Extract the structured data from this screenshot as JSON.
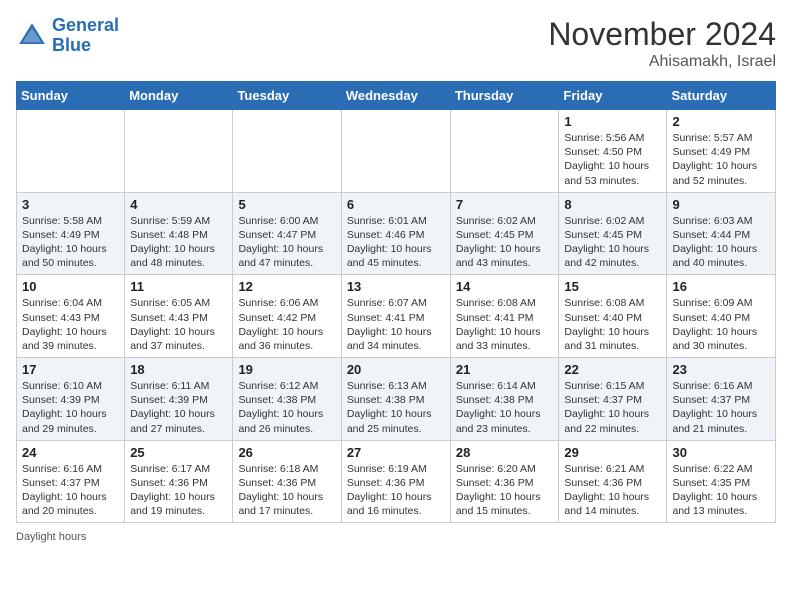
{
  "header": {
    "logo_line1": "General",
    "logo_line2": "Blue",
    "month": "November 2024",
    "location": "Ahisamakh, Israel"
  },
  "footer": {
    "daylight_label": "Daylight hours"
  },
  "weekdays": [
    "Sunday",
    "Monday",
    "Tuesday",
    "Wednesday",
    "Thursday",
    "Friday",
    "Saturday"
  ],
  "weeks": [
    [
      {
        "day": "",
        "info": ""
      },
      {
        "day": "",
        "info": ""
      },
      {
        "day": "",
        "info": ""
      },
      {
        "day": "",
        "info": ""
      },
      {
        "day": "",
        "info": ""
      },
      {
        "day": "1",
        "info": "Sunrise: 5:56 AM\nSunset: 4:50 PM\nDaylight: 10 hours and 53 minutes."
      },
      {
        "day": "2",
        "info": "Sunrise: 5:57 AM\nSunset: 4:49 PM\nDaylight: 10 hours and 52 minutes."
      }
    ],
    [
      {
        "day": "3",
        "info": "Sunrise: 5:58 AM\nSunset: 4:49 PM\nDaylight: 10 hours and 50 minutes."
      },
      {
        "day": "4",
        "info": "Sunrise: 5:59 AM\nSunset: 4:48 PM\nDaylight: 10 hours and 48 minutes."
      },
      {
        "day": "5",
        "info": "Sunrise: 6:00 AM\nSunset: 4:47 PM\nDaylight: 10 hours and 47 minutes."
      },
      {
        "day": "6",
        "info": "Sunrise: 6:01 AM\nSunset: 4:46 PM\nDaylight: 10 hours and 45 minutes."
      },
      {
        "day": "7",
        "info": "Sunrise: 6:02 AM\nSunset: 4:45 PM\nDaylight: 10 hours and 43 minutes."
      },
      {
        "day": "8",
        "info": "Sunrise: 6:02 AM\nSunset: 4:45 PM\nDaylight: 10 hours and 42 minutes."
      },
      {
        "day": "9",
        "info": "Sunrise: 6:03 AM\nSunset: 4:44 PM\nDaylight: 10 hours and 40 minutes."
      }
    ],
    [
      {
        "day": "10",
        "info": "Sunrise: 6:04 AM\nSunset: 4:43 PM\nDaylight: 10 hours and 39 minutes."
      },
      {
        "day": "11",
        "info": "Sunrise: 6:05 AM\nSunset: 4:43 PM\nDaylight: 10 hours and 37 minutes."
      },
      {
        "day": "12",
        "info": "Sunrise: 6:06 AM\nSunset: 4:42 PM\nDaylight: 10 hours and 36 minutes."
      },
      {
        "day": "13",
        "info": "Sunrise: 6:07 AM\nSunset: 4:41 PM\nDaylight: 10 hours and 34 minutes."
      },
      {
        "day": "14",
        "info": "Sunrise: 6:08 AM\nSunset: 4:41 PM\nDaylight: 10 hours and 33 minutes."
      },
      {
        "day": "15",
        "info": "Sunrise: 6:08 AM\nSunset: 4:40 PM\nDaylight: 10 hours and 31 minutes."
      },
      {
        "day": "16",
        "info": "Sunrise: 6:09 AM\nSunset: 4:40 PM\nDaylight: 10 hours and 30 minutes."
      }
    ],
    [
      {
        "day": "17",
        "info": "Sunrise: 6:10 AM\nSunset: 4:39 PM\nDaylight: 10 hours and 29 minutes."
      },
      {
        "day": "18",
        "info": "Sunrise: 6:11 AM\nSunset: 4:39 PM\nDaylight: 10 hours and 27 minutes."
      },
      {
        "day": "19",
        "info": "Sunrise: 6:12 AM\nSunset: 4:38 PM\nDaylight: 10 hours and 26 minutes."
      },
      {
        "day": "20",
        "info": "Sunrise: 6:13 AM\nSunset: 4:38 PM\nDaylight: 10 hours and 25 minutes."
      },
      {
        "day": "21",
        "info": "Sunrise: 6:14 AM\nSunset: 4:38 PM\nDaylight: 10 hours and 23 minutes."
      },
      {
        "day": "22",
        "info": "Sunrise: 6:15 AM\nSunset: 4:37 PM\nDaylight: 10 hours and 22 minutes."
      },
      {
        "day": "23",
        "info": "Sunrise: 6:16 AM\nSunset: 4:37 PM\nDaylight: 10 hours and 21 minutes."
      }
    ],
    [
      {
        "day": "24",
        "info": "Sunrise: 6:16 AM\nSunset: 4:37 PM\nDaylight: 10 hours and 20 minutes."
      },
      {
        "day": "25",
        "info": "Sunrise: 6:17 AM\nSunset: 4:36 PM\nDaylight: 10 hours and 19 minutes."
      },
      {
        "day": "26",
        "info": "Sunrise: 6:18 AM\nSunset: 4:36 PM\nDaylight: 10 hours and 17 minutes."
      },
      {
        "day": "27",
        "info": "Sunrise: 6:19 AM\nSunset: 4:36 PM\nDaylight: 10 hours and 16 minutes."
      },
      {
        "day": "28",
        "info": "Sunrise: 6:20 AM\nSunset: 4:36 PM\nDaylight: 10 hours and 15 minutes."
      },
      {
        "day": "29",
        "info": "Sunrise: 6:21 AM\nSunset: 4:36 PM\nDaylight: 10 hours and 14 minutes."
      },
      {
        "day": "30",
        "info": "Sunrise: 6:22 AM\nSunset: 4:35 PM\nDaylight: 10 hours and 13 minutes."
      }
    ]
  ]
}
